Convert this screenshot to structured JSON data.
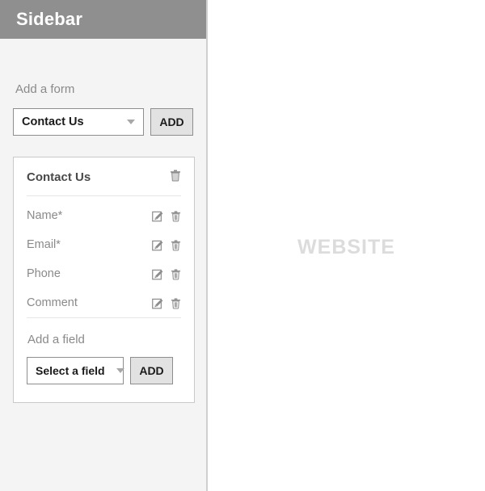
{
  "sidebar": {
    "title": "Sidebar",
    "add_form": {
      "label": "Add a form",
      "select_value": "Contact Us",
      "select_caret_icon": "chevron-down-icon",
      "add_button_label": "ADD"
    },
    "form_card": {
      "title": "Contact Us",
      "delete_icon": "trash-icon",
      "fields": [
        {
          "label": "Name*",
          "edit_icon": "edit-icon",
          "delete_icon": "trash-icon"
        },
        {
          "label": "Email*",
          "edit_icon": "edit-icon",
          "delete_icon": "trash-icon"
        },
        {
          "label": "Phone",
          "edit_icon": "edit-icon",
          "delete_icon": "trash-icon"
        },
        {
          "label": "Comment",
          "edit_icon": "edit-icon",
          "delete_icon": "trash-icon"
        }
      ],
      "add_field": {
        "label": "Add a field",
        "select_value": "Select a field",
        "select_caret_icon": "chevron-down-icon",
        "add_button_label": "ADD"
      }
    }
  },
  "canvas": {
    "watermark": "WEBSITE"
  },
  "colors": {
    "sidebar_header_bg": "#8f8f8f",
    "sidebar_bg": "#f4f4f4",
    "button_bg": "#e2e2e2",
    "muted_text": "#8a8a8a",
    "watermark_text": "#dcdcdc"
  }
}
